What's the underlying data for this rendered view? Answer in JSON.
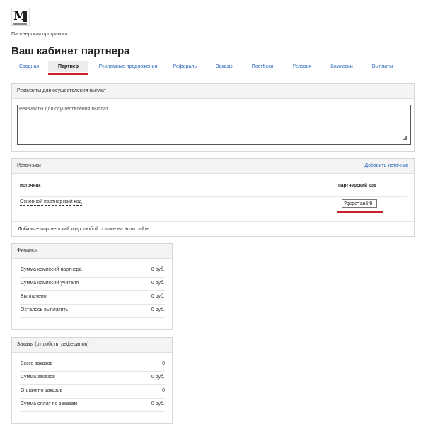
{
  "breadcrumb": "Партнерская программа",
  "page_title": "Ваш кабинет партнера",
  "tabs": [
    {
      "label": "Сводная"
    },
    {
      "label": "Партнер"
    },
    {
      "label": "Рекламные предложения"
    },
    {
      "label": "Рефералы"
    },
    {
      "label": "Заказы"
    },
    {
      "label": "Постбеки"
    },
    {
      "label": "Условия"
    },
    {
      "label": "Комиссии"
    },
    {
      "label": "Выплаты"
    }
  ],
  "active_tab": "Партнер",
  "requisites": {
    "header": "Реквизиты для осуществления выплат",
    "placeholder": "Реквизиты для осуществления выплат"
  },
  "sources": {
    "header": "Источники",
    "add_link": "Добавить источник",
    "col_source": "источник",
    "col_code": "партнерский код",
    "row_name": "Основной партнерский код",
    "row_code": "?gcpc=ae5f9",
    "footer": "Добавьте партнерский код к любой ссылке на этом сайте"
  },
  "finance": {
    "header": "Финансы",
    "rows": [
      {
        "label": "Сумма комиссий партнера",
        "value": "0 руб."
      },
      {
        "label": "Сумма комиссий учителя",
        "value": "0 руб."
      },
      {
        "label": "Выплачено",
        "value": "0 руб."
      },
      {
        "label": "Осталось выплатить",
        "value": "0 руб."
      }
    ]
  },
  "orders": {
    "header": "Заказы (от собств. рефералов)",
    "rows": [
      {
        "label": "Всего заказов",
        "value": "0"
      },
      {
        "label": "Сумма заказов",
        "value": "0 руб."
      },
      {
        "label": "Оплачено заказов",
        "value": "0"
      },
      {
        "label": "Сумма оплат по заказам",
        "value": "0 руб."
      }
    ]
  },
  "colors": {
    "accent_red": "#c8202a",
    "link_blue": "#2a66b8"
  }
}
